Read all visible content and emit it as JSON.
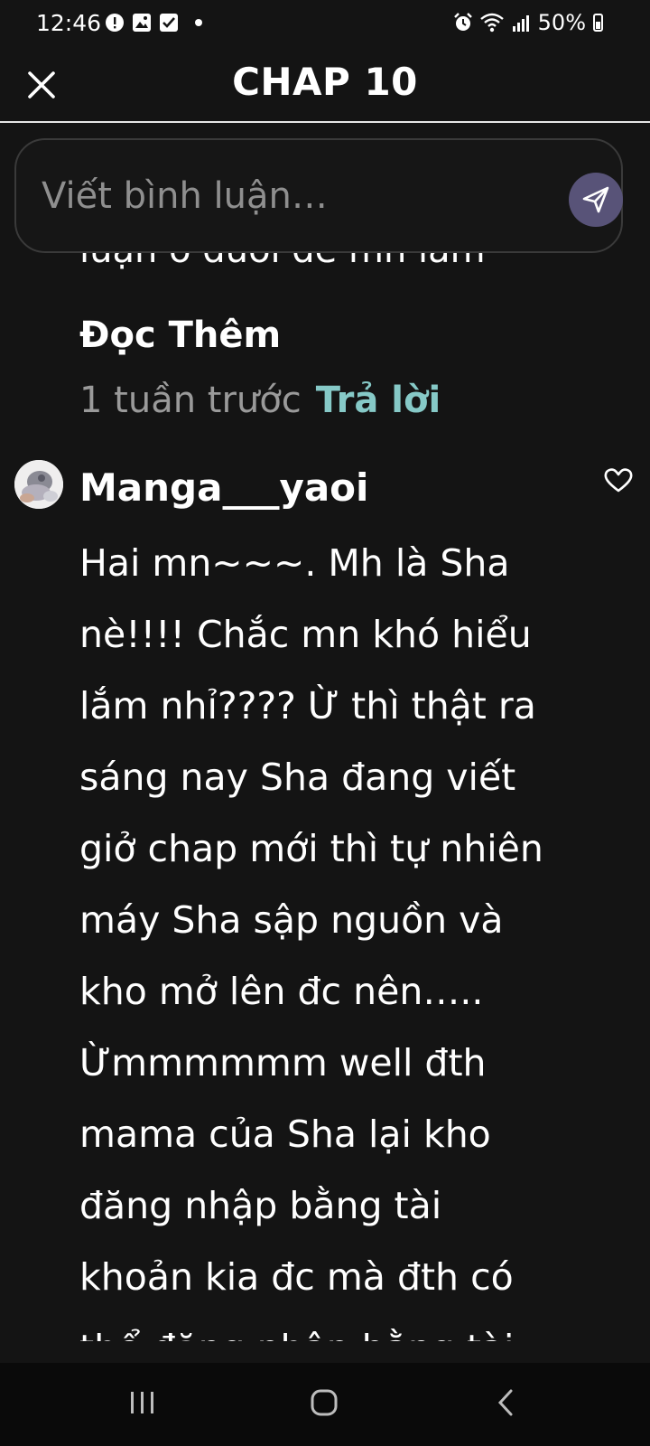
{
  "status_bar": {
    "time": "12:46",
    "battery": "50%"
  },
  "header": {
    "title": "CHAP 10"
  },
  "comment_input": {
    "placeholder": "Viết bình luận…"
  },
  "previous_comment": {
    "text_fragment": "luận ở dưới để mn làm",
    "read_more_label": "Đọc Thêm",
    "time_ago": "1 tuần trước",
    "reply_label": "Trả lời"
  },
  "comment": {
    "username": "Manga___yaoi",
    "body": "Hai mn~~~. Mh là Sha\nnè!!!! Chắc mn khó hiểu\nlắm nhỉ???? Ừ thì thật ra\nsáng nay Sha đang viết\ngiở chap mới thì tự nhiên\nmáy Sha sập nguồn và\nkho mở lên đc nên…..\nỪmmmmmm well đth\nmama của Sha lại kho\nđăng nhập bằng tài\nkhoản kia đc mà đth có\nthể đăng nhập bằng tài"
  },
  "icons": {
    "close": "close-icon",
    "send": "send-icon",
    "like": "heart-icon",
    "nav_recents": "recents-icon",
    "nav_home": "home-icon",
    "nav_back": "back-icon"
  },
  "colors": {
    "background": "#141414",
    "reply_accent": "#86c9c7",
    "send_button": "#585378",
    "muted_text": "#9a9a9a"
  }
}
